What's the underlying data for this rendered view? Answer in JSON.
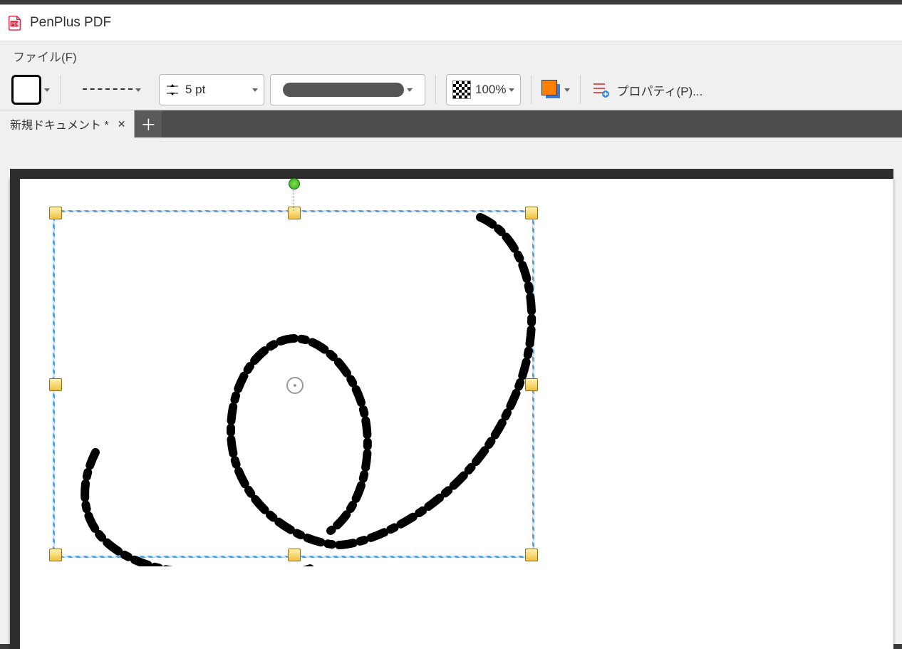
{
  "app": {
    "title": "PenPlus PDF"
  },
  "menu": {
    "file": "ファイル(F)"
  },
  "toolbar": {
    "weight_label": "5 pt",
    "opacity_label": "100%",
    "properties_label": "プロパティ(P)..."
  },
  "tabs": {
    "active": "新規ドキュメント *"
  }
}
